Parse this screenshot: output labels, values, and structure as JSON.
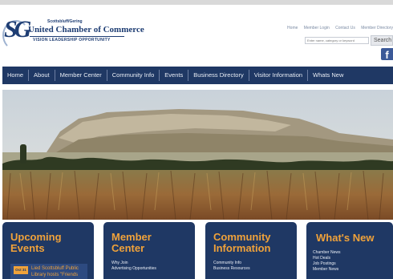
{
  "header": {
    "logo": {
      "monogram": "SG",
      "subtitle": "Scottsbluff/Gering",
      "name": "United Chamber of Commerce",
      "tagline": "VISION   LEADERSHIP   OPPORTUNITY"
    },
    "utility_links": [
      "Home",
      "Member Login",
      "Contact Us",
      "Member Directory"
    ],
    "search": {
      "placeholder": "Enter name, category or keyword",
      "button_label": "Search"
    },
    "social": {
      "facebook_label": "f"
    }
  },
  "nav": {
    "items": [
      "Home",
      "About",
      "Member Center",
      "Community Info",
      "Events",
      "Business Directory",
      "Visitor Information",
      "Whats New"
    ]
  },
  "cards": {
    "events": {
      "title_line1": "Upcoming",
      "title_line2": "Events",
      "event": {
        "date": "Oct 31",
        "text": "Lied Scottsbluff Public Library hosts \"Friends"
      }
    },
    "member_center": {
      "title_line1": "Member",
      "title_line2": "Center",
      "links": [
        "Why Join",
        "Advertising Opportunities"
      ]
    },
    "community": {
      "title_line1": "Community",
      "title_line2": "Information",
      "links": [
        "Community Info",
        "Business Resources"
      ]
    },
    "whats_new": {
      "title": "What's New",
      "links": [
        "Chamber News",
        "Hot Deals",
        "Job Postings",
        "Member News"
      ]
    }
  },
  "colors": {
    "navy": "#1f3864",
    "accent_orange": "#f0a23a",
    "nav_text": "#e8edf5",
    "facebook_blue": "#3b5998"
  }
}
